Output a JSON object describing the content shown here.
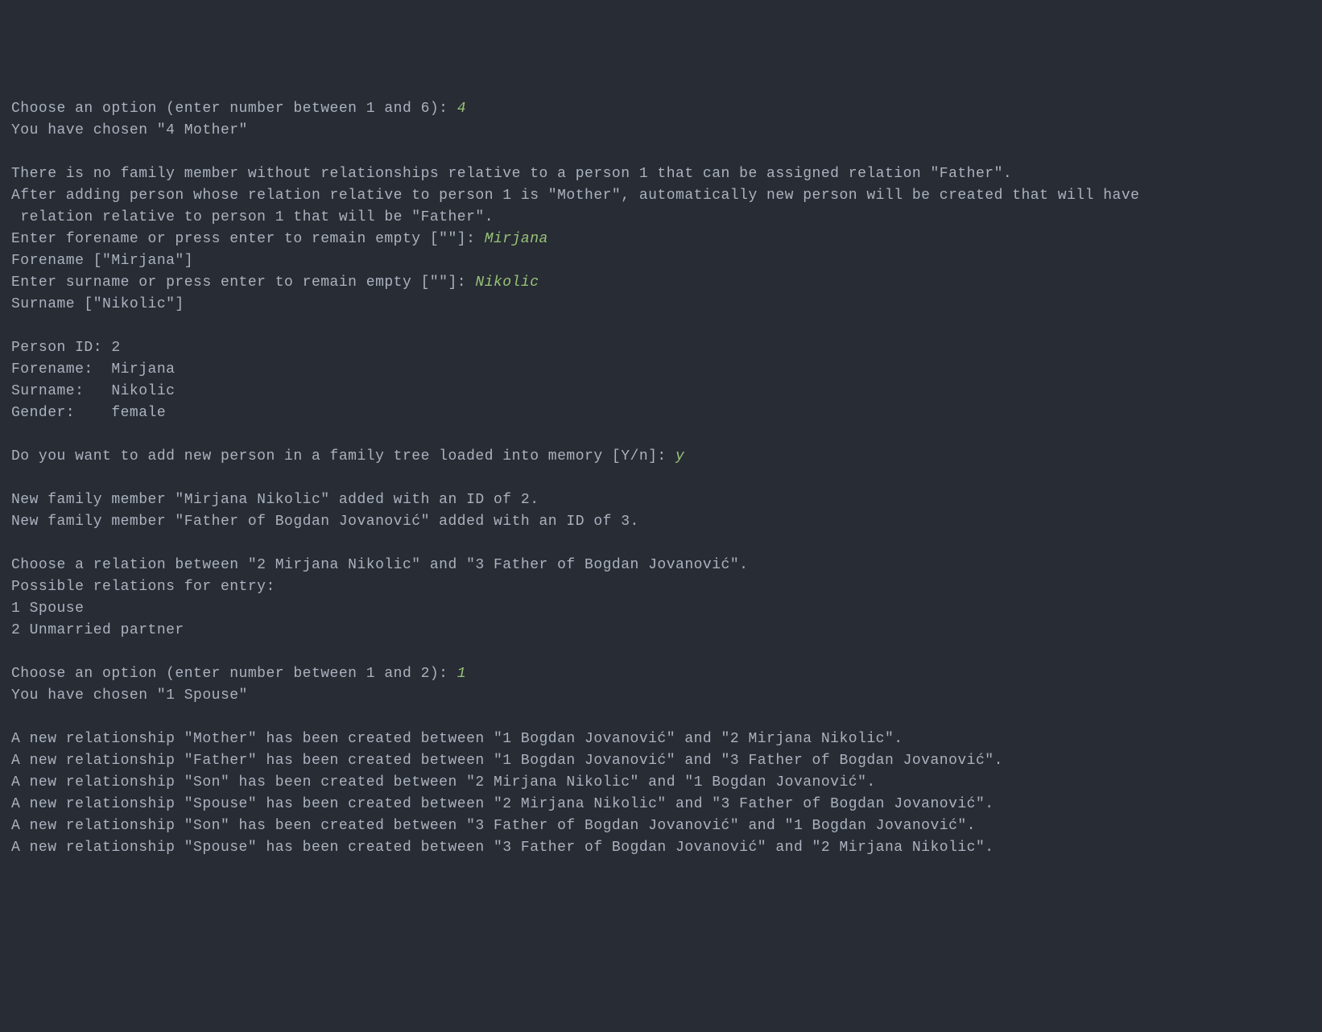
{
  "lines": [
    {
      "type": "prompt-input",
      "prompt": "Choose an option (enter number between 1 and 6): ",
      "input": "4"
    },
    {
      "type": "text",
      "text": "You have chosen \"4 Mother\""
    },
    {
      "type": "blank"
    },
    {
      "type": "text",
      "text": "There is no family member without relationships relative to a person 1 that can be assigned relation \"Father\"."
    },
    {
      "type": "text",
      "text": "After adding person whose relation relative to person 1 is \"Mother\", automatically new person will be created that will have"
    },
    {
      "type": "text",
      "text": " relation relative to person 1 that will be \"Father\"."
    },
    {
      "type": "prompt-input",
      "prompt": "Enter forename or press enter to remain empty [\"\"]: ",
      "input": "Mirjana"
    },
    {
      "type": "text",
      "text": "Forename [\"Mirjana\"]"
    },
    {
      "type": "prompt-input",
      "prompt": "Enter surname or press enter to remain empty [\"\"]: ",
      "input": "Nikolic"
    },
    {
      "type": "text",
      "text": "Surname [\"Nikolic\"]"
    },
    {
      "type": "blank"
    },
    {
      "type": "text",
      "text": "Person ID: 2"
    },
    {
      "type": "text",
      "text": "Forename:  Mirjana"
    },
    {
      "type": "text",
      "text": "Surname:   Nikolic"
    },
    {
      "type": "text",
      "text": "Gender:    female"
    },
    {
      "type": "blank"
    },
    {
      "type": "prompt-input",
      "prompt": "Do you want to add new person in a family tree loaded into memory [Y/n]: ",
      "input": "y"
    },
    {
      "type": "blank"
    },
    {
      "type": "text",
      "text": "New family member \"Mirjana Nikolic\" added with an ID of 2."
    },
    {
      "type": "text",
      "text": "New family member \"Father of Bogdan Jovanović\" added with an ID of 3."
    },
    {
      "type": "blank"
    },
    {
      "type": "text",
      "text": "Choose a relation between \"2 Mirjana Nikolic\" and \"3 Father of Bogdan Jovanović\"."
    },
    {
      "type": "text",
      "text": "Possible relations for entry:"
    },
    {
      "type": "text",
      "text": "1 Spouse"
    },
    {
      "type": "text",
      "text": "2 Unmarried partner"
    },
    {
      "type": "blank"
    },
    {
      "type": "prompt-input",
      "prompt": "Choose an option (enter number between 1 and 2): ",
      "input": "1"
    },
    {
      "type": "text",
      "text": "You have chosen \"1 Spouse\""
    },
    {
      "type": "blank"
    },
    {
      "type": "text",
      "text": "A new relationship \"Mother\" has been created between \"1 Bogdan Jovanović\" and \"2 Mirjana Nikolic\"."
    },
    {
      "type": "text",
      "text": "A new relationship \"Father\" has been created between \"1 Bogdan Jovanović\" and \"3 Father of Bogdan Jovanović\"."
    },
    {
      "type": "text",
      "text": "A new relationship \"Son\" has been created between \"2 Mirjana Nikolic\" and \"1 Bogdan Jovanović\"."
    },
    {
      "type": "text",
      "text": "A new relationship \"Spouse\" has been created between \"2 Mirjana Nikolic\" and \"3 Father of Bogdan Jovanović\"."
    },
    {
      "type": "text",
      "text": "A new relationship \"Son\" has been created between \"3 Father of Bogdan Jovanović\" and \"1 Bogdan Jovanović\"."
    },
    {
      "type": "text",
      "text": "A new relationship \"Spouse\" has been created between \"3 Father of Bogdan Jovanović\" and \"2 Mirjana Nikolic\"."
    }
  ]
}
